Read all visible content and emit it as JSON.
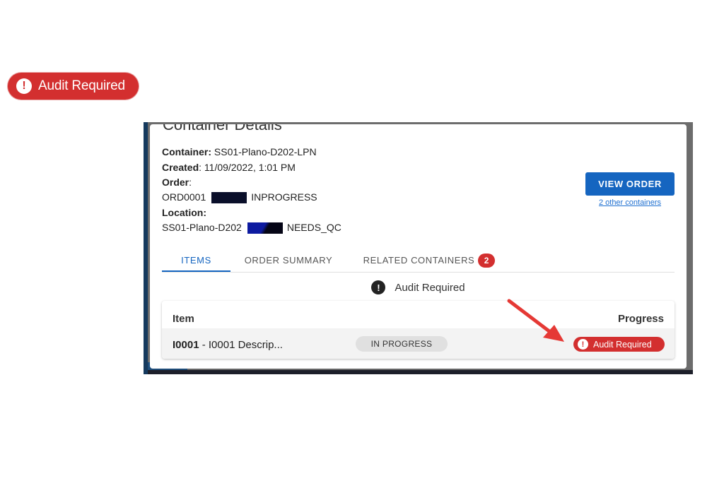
{
  "callout": {
    "icon": "exclamation-circle-icon",
    "label": "Audit Required"
  },
  "card": {
    "title": "Container Details",
    "container_label": "Container:",
    "container_value": "SS01-Plano-D202-LPN",
    "created_label": "Created",
    "created_value": ": 11/09/2022, 1:01 PM",
    "order_label": "Order",
    "order_colon": ":",
    "order_id": "ORD0001",
    "order_status": "INPROGRESS",
    "location_label": "Location:",
    "location_id": "SS01-Plano-D202",
    "location_status": "NEEDS_QC",
    "view_order_label": "VIEW ORDER",
    "other_containers_link": "2 other containers"
  },
  "tabs": [
    {
      "label": "ITEMS",
      "active": true
    },
    {
      "label": "ORDER SUMMARY",
      "active": false
    },
    {
      "label": "RELATED CONTAINERS",
      "active": false,
      "count": "2"
    }
  ],
  "audit_banner": {
    "icon": "exclamation-circle-icon",
    "label": "Audit Required"
  },
  "table": {
    "headers": {
      "item": "Item",
      "progress": "Progress"
    },
    "rows": [
      {
        "item_id": "I0001",
        "item_desc": " - I0001 Descrip...",
        "status": "IN PROGRESS",
        "progress_badge": "Audit Required"
      }
    ]
  },
  "colors": {
    "danger": "#d32f2f",
    "primary": "#1565c0",
    "annotation_arrow": "#e53935"
  }
}
